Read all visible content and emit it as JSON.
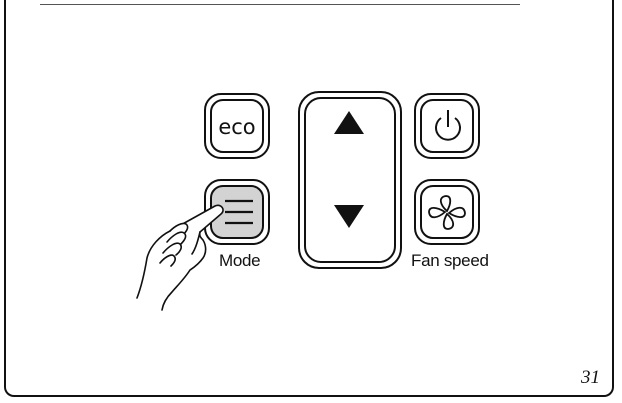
{
  "panel": {
    "eco_label": "eco",
    "mode_label": "Mode",
    "fan_speed_label": "Fan speed",
    "up_icon": "triangle-up-icon",
    "down_icon": "triangle-down-icon",
    "power_icon": "power-icon",
    "mode_icon": "menu-lines-icon",
    "fan_icon": "fan-icon",
    "hand_icon": "pointing-hand-icon",
    "mode_button_highlight": "#d3d3d3"
  },
  "page_number": "31"
}
